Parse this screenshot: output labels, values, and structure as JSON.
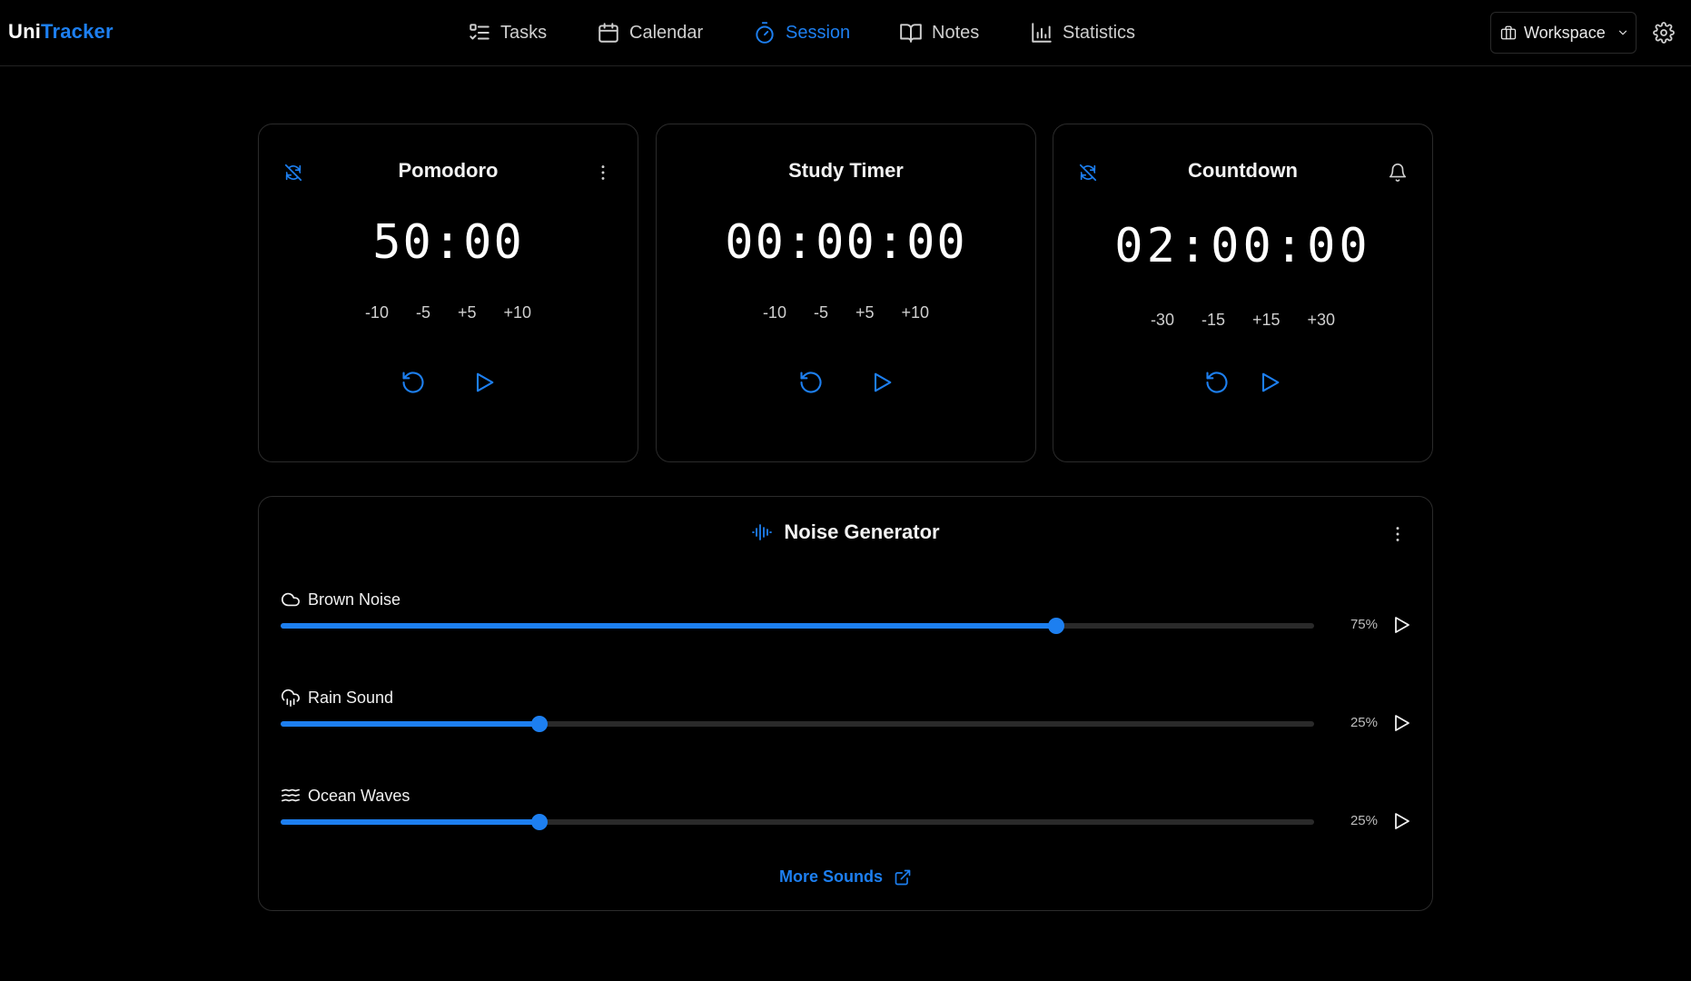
{
  "app": {
    "name_part1": "Uni",
    "name_part2": "Tracker"
  },
  "nav": {
    "items": [
      {
        "label": "Tasks",
        "icon": "tasks-icon"
      },
      {
        "label": "Calendar",
        "icon": "calendar-icon"
      },
      {
        "label": "Session",
        "icon": "timer-icon",
        "active": true
      },
      {
        "label": "Notes",
        "icon": "book-icon"
      },
      {
        "label": "Statistics",
        "icon": "bar-chart-icon"
      }
    ]
  },
  "workspace": {
    "label": "Workspace"
  },
  "timers": [
    {
      "title": "Pomodoro",
      "time": "50:00",
      "adjustments": [
        "-10",
        "-5",
        "+5",
        "+10"
      ],
      "left_icon": "sync-off-icon",
      "right_icon": "more-vertical-icon"
    },
    {
      "title": "Study Timer",
      "time": "00:00:00",
      "adjustments": [
        "-10",
        "-5",
        "+5",
        "+10"
      ]
    },
    {
      "title": "Countdown",
      "time": "02:00:00",
      "adjustments": [
        "-30",
        "-15",
        "+15",
        "+30"
      ],
      "left_icon": "sync-off-icon",
      "right_icon": "bell-icon"
    }
  ],
  "noise": {
    "title": "Noise Generator",
    "tracks": [
      {
        "label": "Brown Noise",
        "icon": "cloud-icon",
        "value": 75,
        "value_label": "75%"
      },
      {
        "label": "Rain Sound",
        "icon": "rain-cloud-icon",
        "value": 25,
        "value_label": "25%"
      },
      {
        "label": "Ocean Waves",
        "icon": "waves-icon",
        "value": 25,
        "value_label": "25%"
      }
    ],
    "more_label": "More Sounds"
  },
  "colors": {
    "accent": "#1d7ff0",
    "background": "#000000",
    "border": "#2b2b2b"
  }
}
